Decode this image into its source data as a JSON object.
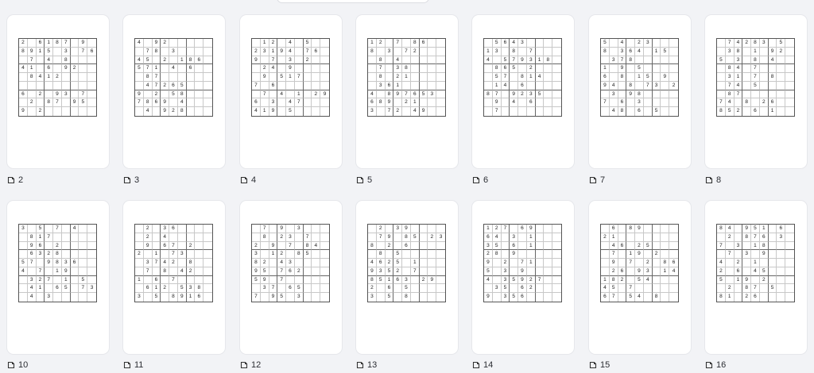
{
  "pages": [
    {
      "label": "2",
      "grid": [
        "2 6187 9",
        "8915 3 76",
        " 7 4 8 ",
        "41 6 92",
        " 8412 ",
        "",
        "6 2 93 7",
        " 2 87 95",
        "9 2 "
      ]
    },
    {
      "label": "3",
      "grid": [
        "4 92",
        " 78 3",
        "45 2 186",
        "571 4 6",
        " 87",
        " 47265 ",
        "9 2 58",
        "7869 4",
        " 4 928"
      ]
    },
    {
      "label": "4",
      "grid": [
        " 12 4 5",
        "23194 76",
        "9 7 3 2",
        " 24 9",
        " 9 517 ",
        "7 6",
        " 7 4 1 29",
        "6 3 47",
        "419 5"
      ]
    },
    {
      "label": "5",
      "grid": [
        "12 7 86",
        "8 3 72",
        " 8 4",
        " 7 38 ",
        " 8 21",
        " 361 ",
        "4 897653",
        "689 21",
        "3 72 49"
      ]
    },
    {
      "label": "6",
      "grid": [
        " 5643",
        "13 8 7",
        "4 579318",
        " 865 2",
        " 57 814",
        " 14 6",
        "87 9235",
        " 9 4 6",
        " 7 "
      ]
    },
    {
      "label": "7",
      "grid": [
        "5 4 23",
        "8 364 15",
        " 378",
        "1 9 5",
        "6 8 15 9",
        "94 8 73 2",
        " 3 98 ",
        "7 6 3",
        " 48 6 5"
      ]
    },
    {
      "label": "8",
      "grid": [
        " 74283 5",
        " 38 1 92",
        "5 3 8 4",
        " 84 7",
        " 31 7 8",
        " 74 5 ",
        " 87",
        "74 8 26",
        "852 6 1"
      ]
    },
    {
      "label": "10",
      "grid": [
        "3 5 7 4",
        " 817 ",
        " 96 2",
        " 6328 ",
        "57 9836",
        "4 7 19",
        " 327 1 5",
        " 41 65 73",
        " 4 3 "
      ]
    },
    {
      "label": "11",
      "grid": [
        " 2 36",
        " 2 4",
        " 9 67 2",
        "2 1 73",
        " 3742 8",
        " 7 8 42",
        "1 6 7",
        " 612 538",
        "3 5 8916"
      ]
    },
    {
      "label": "12",
      "grid": [
        " 7 9 3",
        " 8 23 7",
        "2 9 7 84",
        "3 12 85",
        "82 43 ",
        "95 762",
        "59 7",
        " 37 65 ",
        "7 95 3"
      ]
    },
    {
      "label": "13",
      "grid": [
        " 2 39 ",
        " 79 85 23",
        "8 2 6",
        " 8 5 ",
        "4625 1",
        "9352 7 ",
        "85163 29",
        "2 6 5",
        "3 5 8"
      ]
    },
    {
      "label": "14",
      "grid": [
        "127 69",
        "64 3 1",
        "35 6 1 ",
        "28 9",
        "9 2 71 ",
        "5 3 9",
        "4 35927",
        " 35 62 ",
        "9 356"
      ]
    },
    {
      "label": "15",
      "grid": [
        " 6 89",
        "21 ",
        " 46 25",
        " 7 19 2",
        " 9 7 2 86",
        " 26 93 14",
        "182 54",
        "45 7 ",
        "67 54 8"
      ]
    },
    {
      "label": "16",
      "grid": [
        "84 951 6",
        " 2 876 3",
        "7 3 18",
        " 7 3 9",
        "4 2 1",
        "2 6 45 ",
        "5 19 2",
        " 2 87 5",
        "81 26 "
      ]
    }
  ]
}
